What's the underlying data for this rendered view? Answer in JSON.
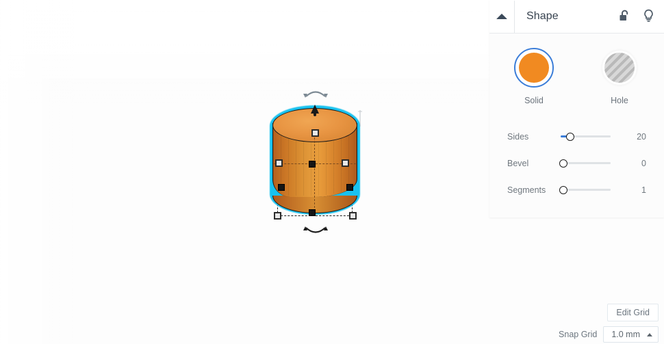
{
  "viewport": {
    "name": "3d-workplane",
    "grid_color": "#6ec8eb",
    "grid_major_color": "#2882aa",
    "plane_fill": "#f2fafd",
    "background": "#fdfdfd"
  },
  "object": {
    "name": "cylinder",
    "fill_color": "#e89543",
    "side_dark_color": "#b05a1c",
    "outline_color": "#19c2ef",
    "handle_fill": "#e8e8e8",
    "handle_border": "#2b2b2b",
    "guide_color": "#7a4a1e"
  },
  "panel": {
    "title": "Shape",
    "collapse_icon": "triangle-up-icon",
    "lock_icon": "unlock-icon",
    "light_icon": "lightbulb-icon",
    "modes": [
      {
        "label": "Solid",
        "icon": "solid-swatch-icon",
        "selected": true,
        "color": "#f18a21"
      },
      {
        "label": "Hole",
        "icon": "hole-swatch-icon",
        "selected": false,
        "color": "#b9b9b9"
      }
    ],
    "sliders": [
      {
        "label": "Sides",
        "value": "20",
        "fill_percent": 8,
        "knob_percent": 8
      },
      {
        "label": "Bevel",
        "value": "0",
        "fill_percent": 0,
        "knob_percent": 0
      },
      {
        "label": "Segments",
        "value": "1",
        "fill_percent": 0,
        "knob_percent": 0
      }
    ],
    "accent_color": "#3b7dd8"
  },
  "footer": {
    "edit_grid_label": "Edit Grid",
    "snap_grid_label": "Snap Grid",
    "snap_grid_value": "1.0 mm",
    "snap_caret_icon": "triangle-up-icon"
  }
}
